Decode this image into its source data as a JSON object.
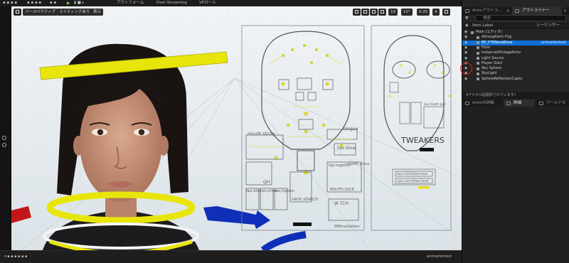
{
  "toolbar": {
    "items": [
      "アウトフォーム",
      "Pixel Streaming",
      "VPロール"
    ]
  },
  "viewport_bar": {
    "perspective": "パースペクティブ",
    "lighting": "ライティングあり",
    "show": "表示",
    "grid_value": "10",
    "rotate_value": "10°",
    "scale_value": "0.25",
    "camera_value": "4"
  },
  "rig": {
    "labels": {
      "mouth_sticky": "mouth sticky",
      "tongue": "tongue",
      "lips_blow": "lips blow",
      "lips_together": "lips together",
      "mouth_press": "mouth press",
      "mouth_suck": "MOUTH SUCK",
      "qh": "QH",
      "lips_bite": "lips bite",
      "lips_prints": "lips prints",
      "lips_tighten": "lips tighten",
      "neck_stretch": "neck stretch",
      "watch": "W TCH",
      "wm_multipliers": "WMmultipliers",
      "tweakers": "TWEAKERS",
      "face_gui_follow_head": "face GUI follow head",
      "eyes_aim_follow_head": "eyes aim follow head",
      "lips_tooth_pull": "lips tooth pull"
    }
  },
  "right_panel": {
    "tabs": [
      "Animアウトラ...",
      "アウトライナー"
    ],
    "search_placeholder": "検索",
    "column_item_label": "Item Label",
    "column_type": "シーケンサー",
    "outliner_rows": [
      {
        "label": "Main (エディタ)",
        "type": ""
      },
      {
        "label": "Atmospheric Fog",
        "type": ""
      },
      {
        "label": "BP_P7BNoseBrow",
        "type": "animationtest"
      },
      {
        "label": "Floor",
        "type": ""
      },
      {
        "label": "InstancedFoliageActor",
        "type": ""
      },
      {
        "label": "Light Source",
        "type": ""
      },
      {
        "label": "Player Start",
        "type": ""
      },
      {
        "label": "Sky Sphere",
        "type": ""
      },
      {
        "label": "SkyLight",
        "type": ""
      },
      {
        "label": "SphereReflectionCaptu",
        "type": ""
      }
    ],
    "actor_count": "9アクタ(1個選択されています)",
    "detail_tabs": [
      "Animの詳細",
      "詳細",
      "ワールドセ"
    ]
  },
  "status_bar": {
    "right_text": "animationtest"
  }
}
